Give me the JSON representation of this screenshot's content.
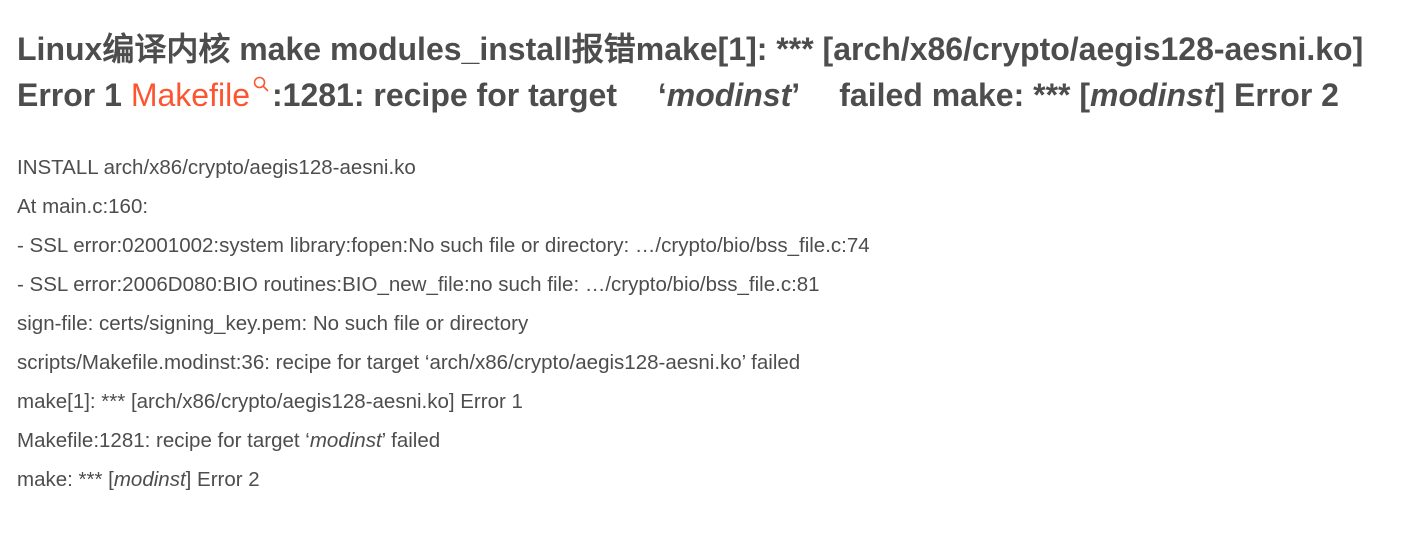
{
  "title": {
    "part1": "Linux编译内核 make modules_install报错make[1]: *** [arch/x86/crypto/aegis128-aesni.ko] Error 1 ",
    "keyword": "Makefile",
    "part2": ":1281: recipe for target 　‘",
    "italic1": "modinst",
    "part3": "’　 failed make: *** [",
    "italic2": "modinst",
    "part4": "] Error 2"
  },
  "icons": {
    "keyword_search": "search-icon"
  },
  "colors": {
    "keyword": "#fc5531",
    "title": "#4d4d4d",
    "text": "#4d4d4d"
  },
  "lines": {
    "l1": "INSTALL arch/x86/crypto/aegis128-aesni.ko",
    "l2": "At main.c:160:",
    "l3": "- SSL error:02001002:system library:fopen:No such file or directory: …/crypto/bio/bss_file.c:74",
    "l4": "- SSL error:2006D080:BIO routines:BIO_new_file:no such file: …/crypto/bio/bss_file.c:81",
    "l5": "sign-file: certs/signing_key.pem: No such file or directory",
    "l6": "scripts/Makefile.modinst:36: recipe for target ‘arch/x86/crypto/aegis128-aesni.ko’ failed",
    "l7": "make[1]: *** [arch/x86/crypto/aegis128-aesni.ko] Error 1",
    "l8": {
      "pre": "Makefile:1281: recipe for target ‘",
      "italic": "modinst",
      "post": "’ failed"
    },
    "l9": {
      "pre": "make: *** [",
      "italic": "modinst",
      "post": "] Error 2"
    }
  }
}
